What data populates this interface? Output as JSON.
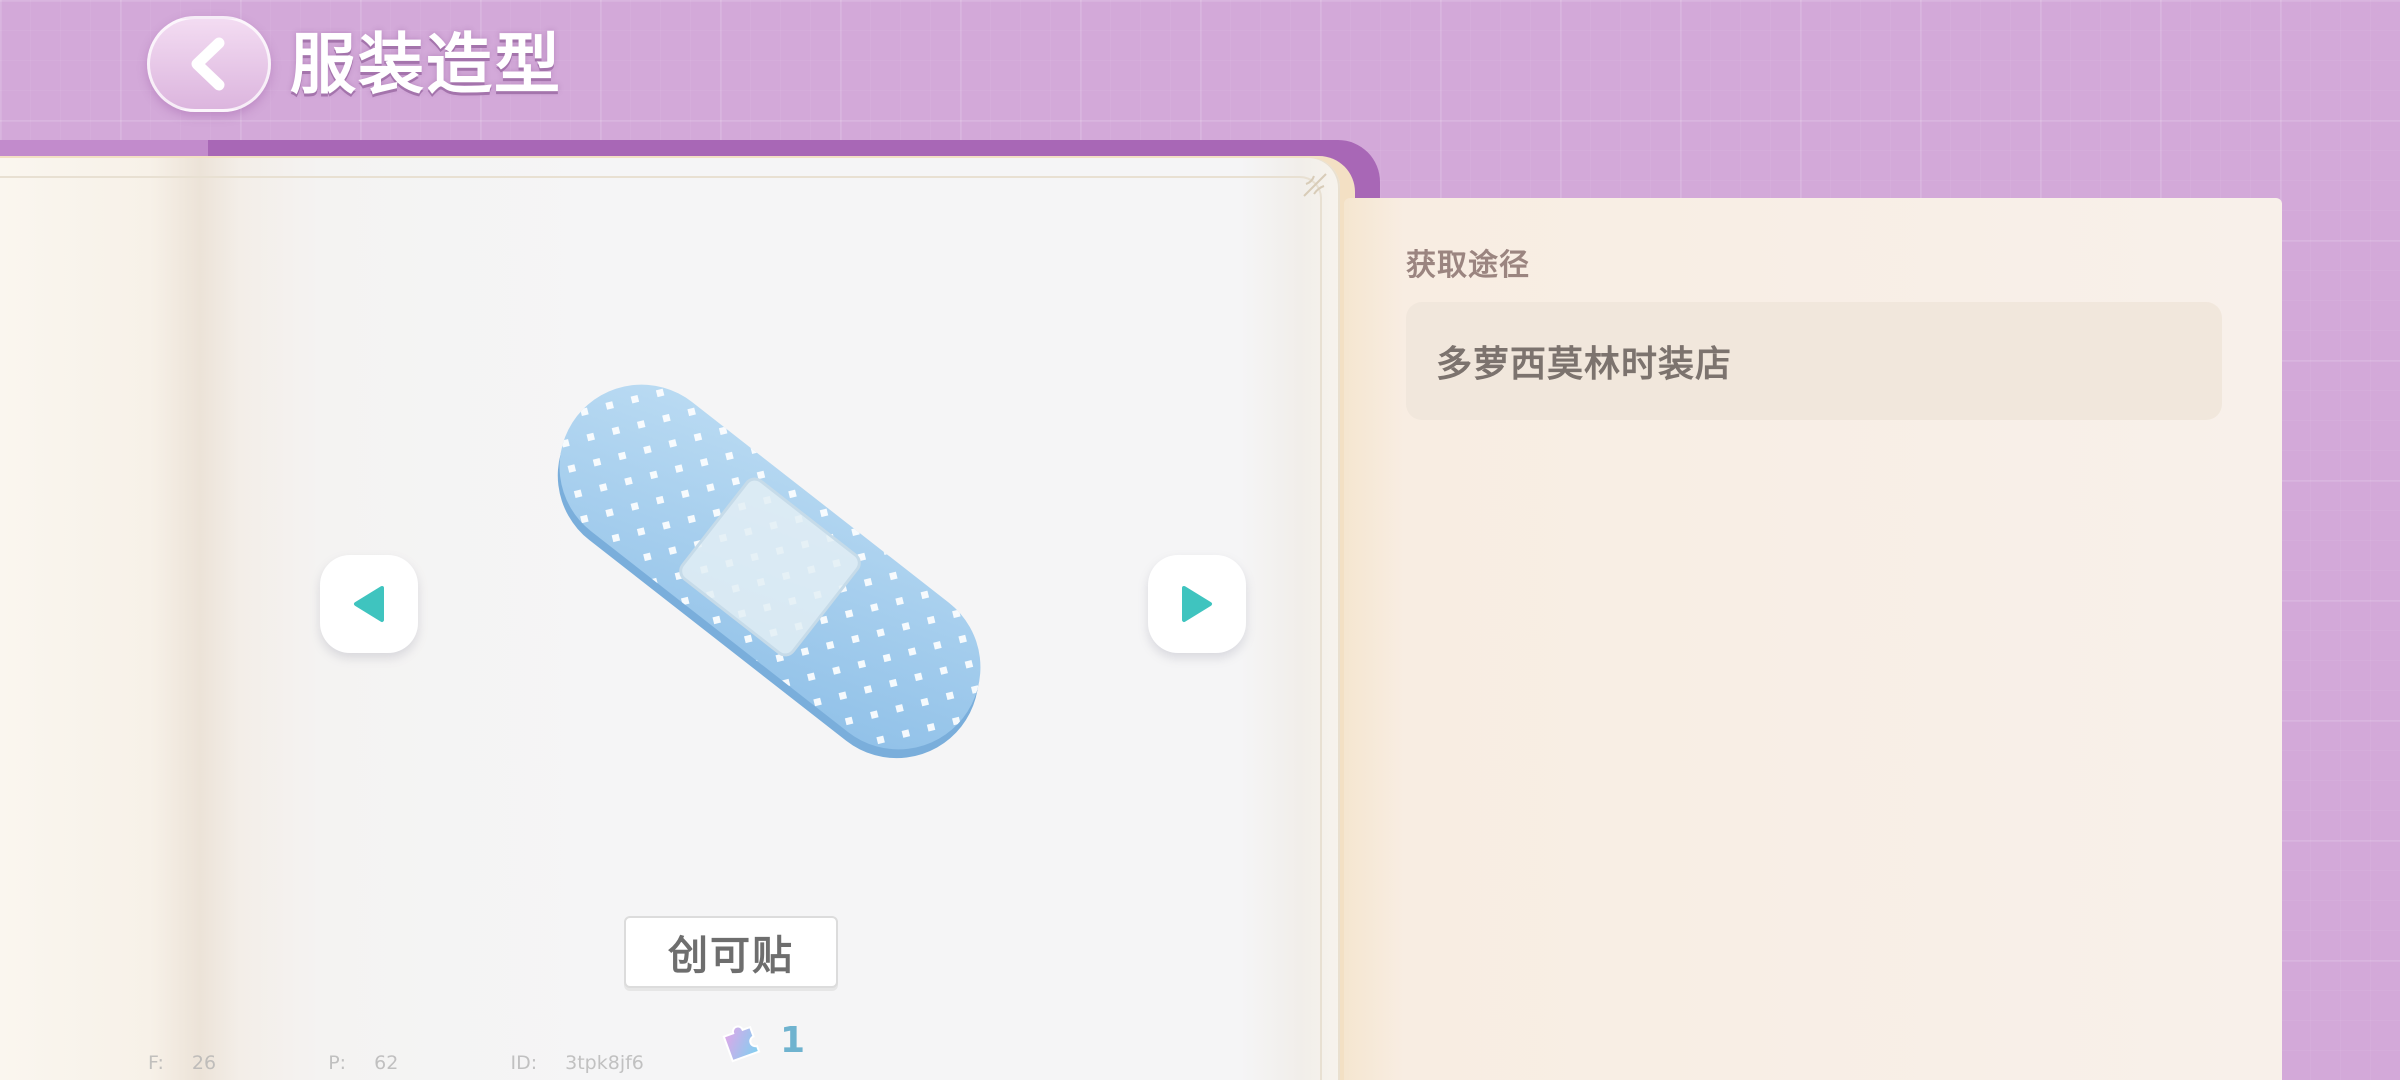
{
  "header": {
    "title": "服装造型",
    "back_icon": "chevron-left-icon"
  },
  "item": {
    "name": "创可贴",
    "count": "1",
    "count_icon": "puzzle-piece-icon",
    "image_icon": "bandage-icon"
  },
  "navigation": {
    "prev_icon": "triangle-left-icon",
    "next_icon": "triangle-right-icon",
    "arrow_color": "#3fc4bf"
  },
  "source_panel": {
    "label": "获取途径",
    "source": "多萝西莫林时装店"
  },
  "debug": {
    "text": "F: 26    P: 62    ID: 3tpk8jf6"
  },
  "colors": {
    "background": "#d3a9d9",
    "book_spine": "#a867b6",
    "panel": "#f8f0ea",
    "bandage": "#a9d2ee"
  }
}
